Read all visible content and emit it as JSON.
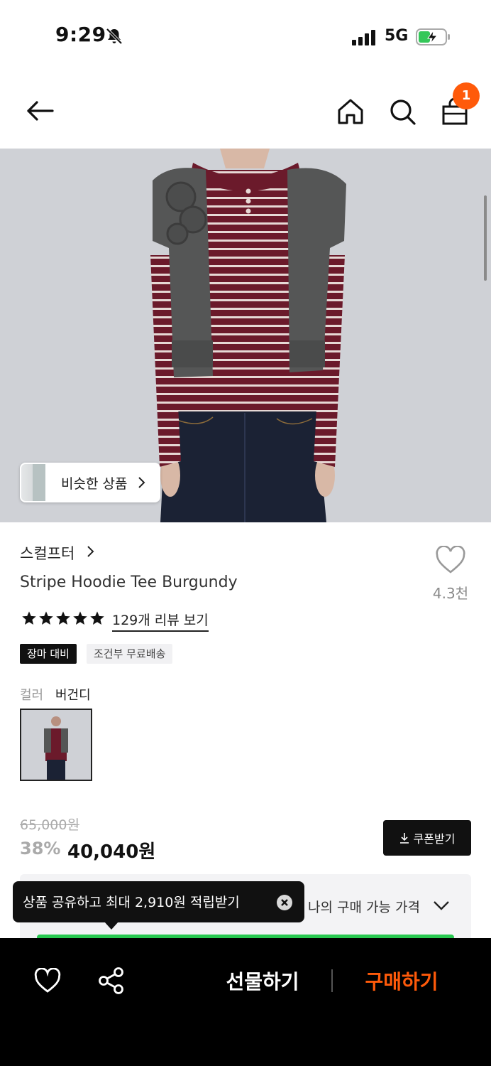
{
  "status_bar": {
    "time": "9:29",
    "network": "5G"
  },
  "header": {
    "cart_count": "1"
  },
  "hero": {
    "similar_label": "비슷한 상품"
  },
  "product": {
    "brand": "스컬프터",
    "name": "Stripe Hoodie Tee Burgundy",
    "like_count": "4.3천",
    "rating_stars": 5,
    "review_link": "129개 리뷰 보기",
    "tags": [
      "장마 대비",
      "조건부 무료배송"
    ],
    "option_label": "컬러",
    "option_value": "버건디"
  },
  "price": {
    "original": "65,000원",
    "discount": "38%",
    "final": "40,040원",
    "coupon_label": "쿠폰받기",
    "my_price_label": "나의 구매 가능 가격"
  },
  "tooltip": {
    "text": "상품 공유하고 최대 2,910원 적립받기"
  },
  "bottom_bar": {
    "gift_label": "선물하기",
    "buy_label": "구매하기"
  },
  "colors": {
    "accent": "#ff5a0a",
    "burgundy": "#6b1a2b",
    "progress": "#28c850"
  }
}
